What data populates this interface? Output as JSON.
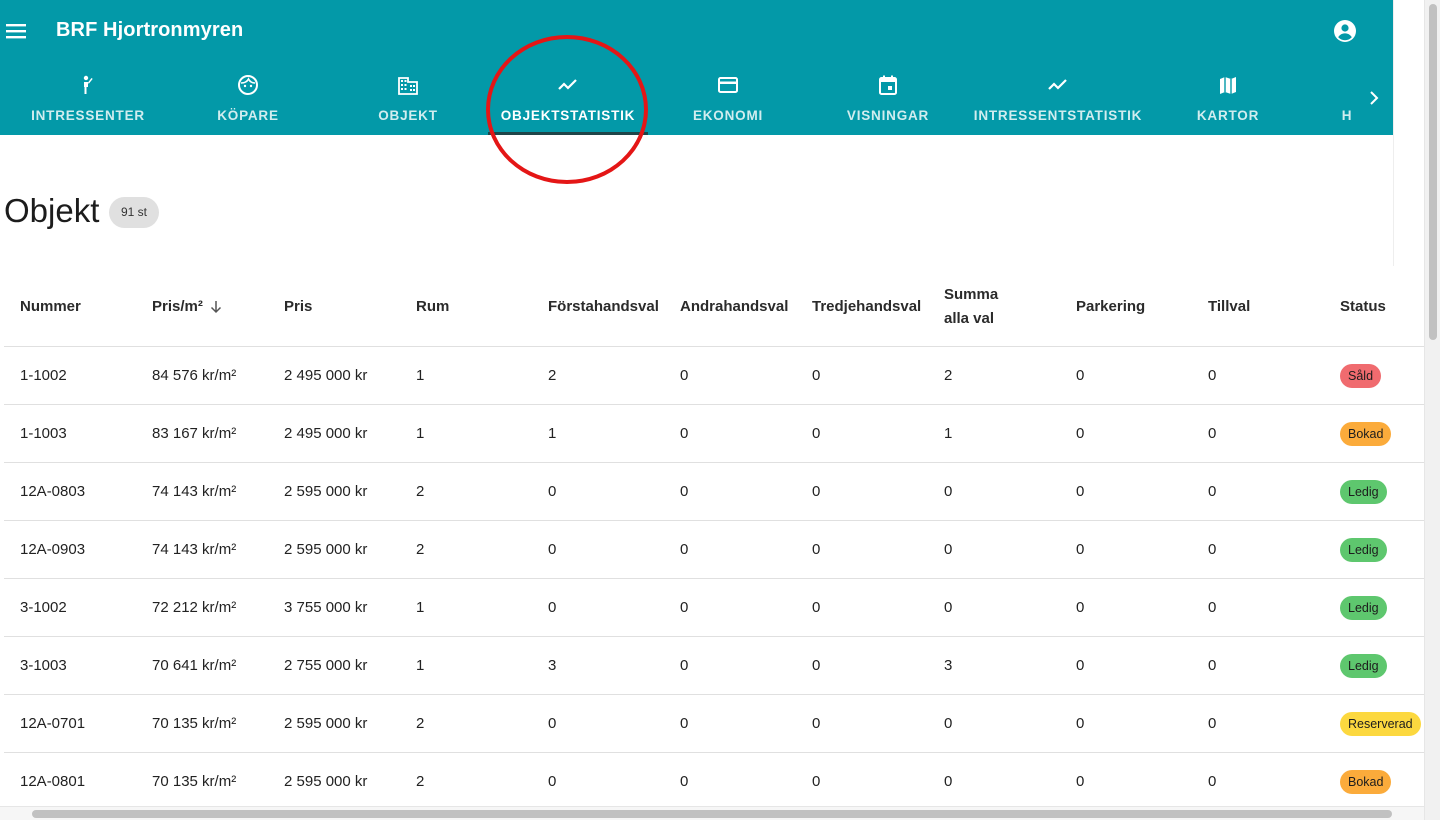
{
  "app": {
    "title": "BRF Hjortronmyren"
  },
  "tabs": [
    {
      "label": "INTRESSENTER",
      "icon": "person-wave-icon",
      "active": false
    },
    {
      "label": "KÖPARE",
      "icon": "face-icon",
      "active": false
    },
    {
      "label": "OBJEKT",
      "icon": "building-icon",
      "active": false
    },
    {
      "label": "OBJEKTSTATISTIK",
      "icon": "trending-line-icon",
      "active": true
    },
    {
      "label": "EKONOMI",
      "icon": "credit-card-icon",
      "active": false
    },
    {
      "label": "VISNINGAR",
      "icon": "calendar-icon",
      "active": false
    },
    {
      "label": "INTRESSENTSTATISTIK",
      "icon": "trending-line-icon",
      "active": false
    },
    {
      "label": "KARTOR",
      "icon": "map-icon",
      "active": false
    },
    {
      "label": "H",
      "icon": "",
      "active": false
    }
  ],
  "page": {
    "title": "Objekt",
    "count": "91 st"
  },
  "table": {
    "columns": [
      "Nummer",
      "Pris/m²",
      "Pris",
      "Rum",
      "Förstahandsval",
      "Andrahandsval",
      "Tredjehandsval",
      "Summa alla val",
      "Parkering",
      "Tillval",
      "Status"
    ],
    "sorted_column": "Pris/m²",
    "sort_direction": "descending",
    "rows": [
      {
        "nummer": "1-1002",
        "pris_m2": "84 576 kr/m²",
        "pris": "2 495 000 kr",
        "rum": "1",
        "forsta": "2",
        "andra": "0",
        "tredje": "0",
        "summa": "2",
        "parkering": "0",
        "tillval": "0",
        "status": "Såld"
      },
      {
        "nummer": "1-1003",
        "pris_m2": "83 167 kr/m²",
        "pris": "2 495 000 kr",
        "rum": "1",
        "forsta": "1",
        "andra": "0",
        "tredje": "0",
        "summa": "1",
        "parkering": "0",
        "tillval": "0",
        "status": "Bokad"
      },
      {
        "nummer": "12A-0803",
        "pris_m2": "74 143 kr/m²",
        "pris": "2 595 000 kr",
        "rum": "2",
        "forsta": "0",
        "andra": "0",
        "tredje": "0",
        "summa": "0",
        "parkering": "0",
        "tillval": "0",
        "status": "Ledig"
      },
      {
        "nummer": "12A-0903",
        "pris_m2": "74 143 kr/m²",
        "pris": "2 595 000 kr",
        "rum": "2",
        "forsta": "0",
        "andra": "0",
        "tredje": "0",
        "summa": "0",
        "parkering": "0",
        "tillval": "0",
        "status": "Ledig"
      },
      {
        "nummer": "3-1002",
        "pris_m2": "72 212 kr/m²",
        "pris": "3 755 000 kr",
        "rum": "1",
        "forsta": "0",
        "andra": "0",
        "tredje": "0",
        "summa": "0",
        "parkering": "0",
        "tillval": "0",
        "status": "Ledig"
      },
      {
        "nummer": "3-1003",
        "pris_m2": "70 641 kr/m²",
        "pris": "2 755 000 kr",
        "rum": "1",
        "forsta": "3",
        "andra": "0",
        "tredje": "0",
        "summa": "3",
        "parkering": "0",
        "tillval": "0",
        "status": "Ledig"
      },
      {
        "nummer": "12A-0701",
        "pris_m2": "70 135 kr/m²",
        "pris": "2 595 000 kr",
        "rum": "2",
        "forsta": "0",
        "andra": "0",
        "tredje": "0",
        "summa": "0",
        "parkering": "0",
        "tillval": "0",
        "status": "Reserverad"
      },
      {
        "nummer": "12A-0801",
        "pris_m2": "70 135 kr/m²",
        "pris": "2 595 000 kr",
        "rum": "2",
        "forsta": "0",
        "andra": "0",
        "tredje": "0",
        "summa": "0",
        "parkering": "0",
        "tillval": "0",
        "status": "Bokad"
      }
    ]
  },
  "colors": {
    "primary": "#0399a8",
    "annotation": "#e41616",
    "status": {
      "Såld": "#f06b6f",
      "Bokad": "#fbab3b",
      "Ledig": "#5ec76e",
      "Reserverad": "#fcd83f"
    }
  }
}
